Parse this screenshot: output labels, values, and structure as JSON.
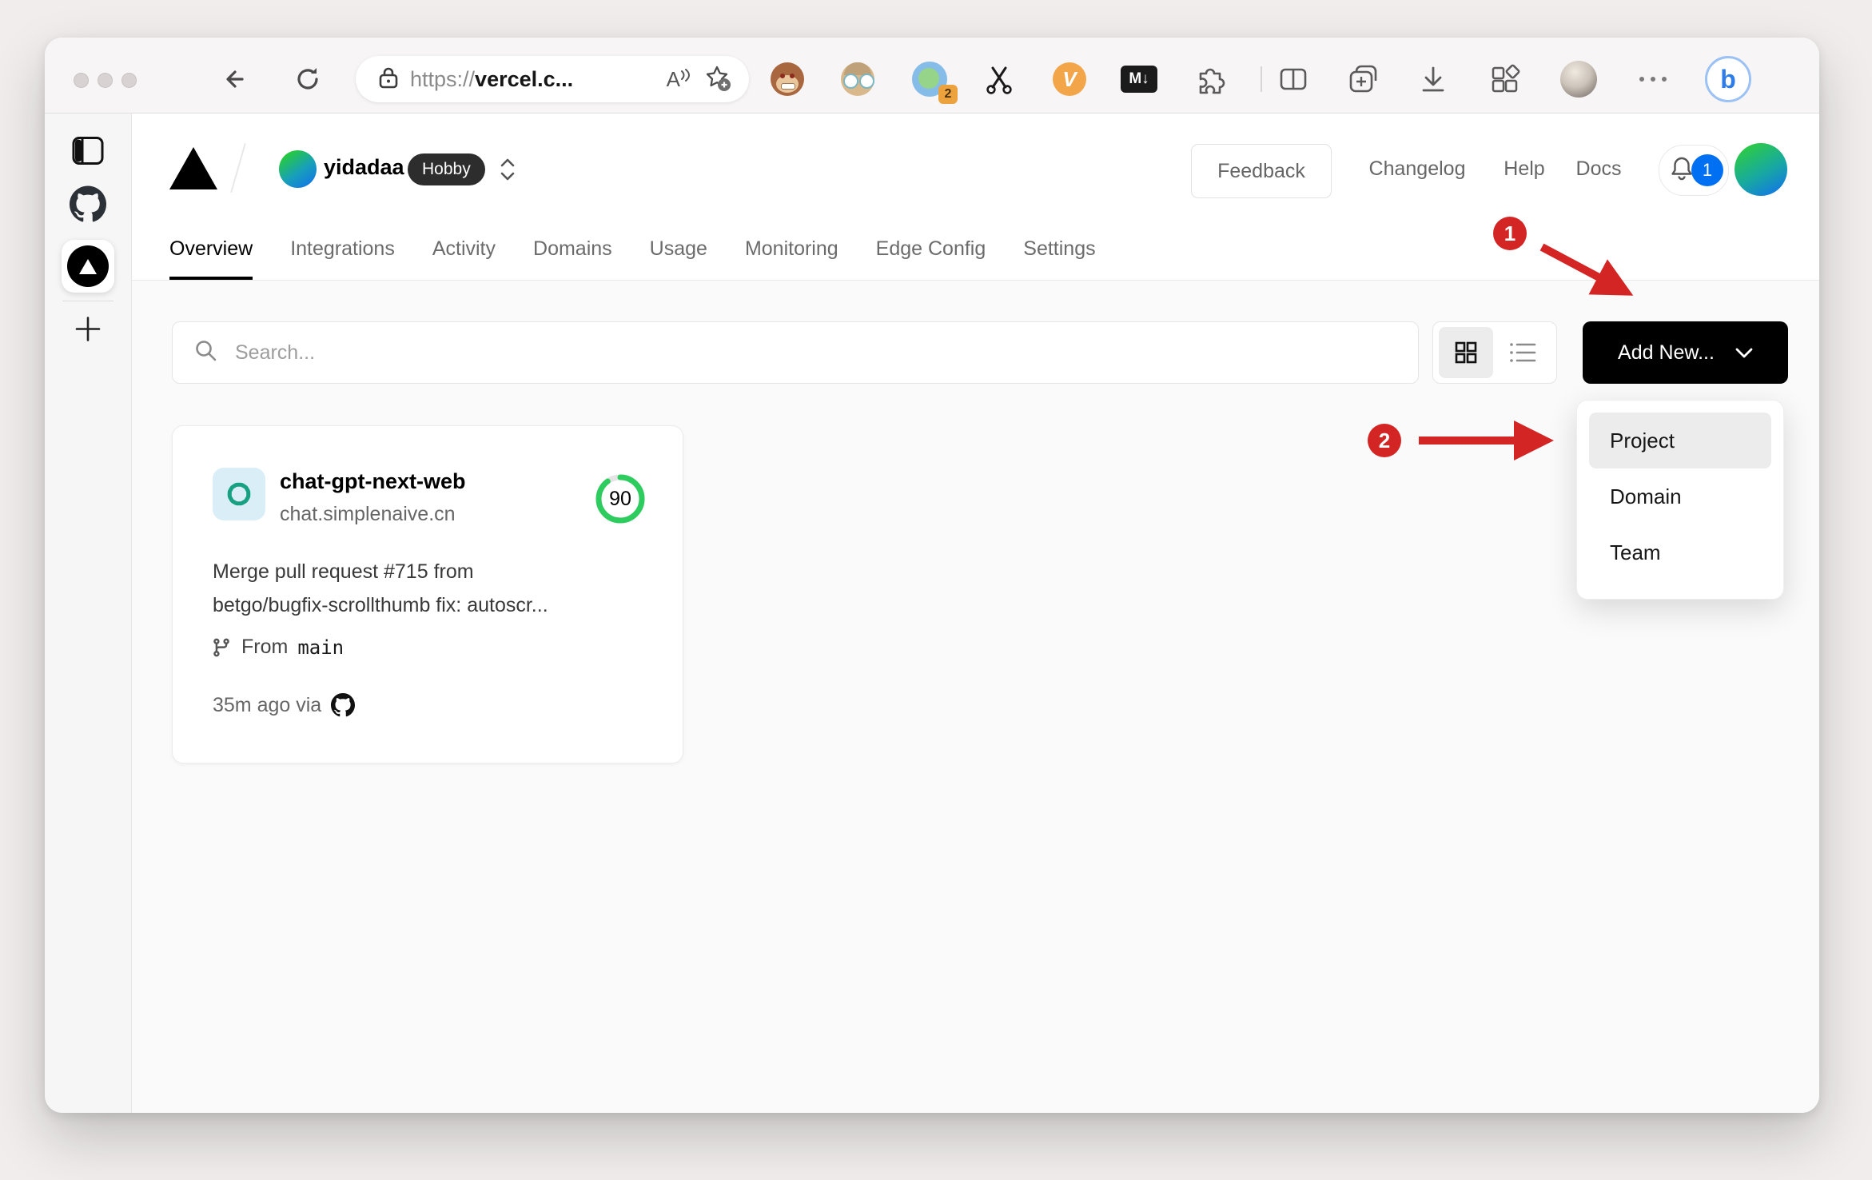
{
  "browser": {
    "url_scheme": "https://",
    "url_host": "vercel.c...",
    "read_aloud_label": "A",
    "ext_badge_count": "2",
    "v_ext_label": "V",
    "markdown_ext_label": "M↓",
    "bing_label": "b"
  },
  "vercel_header": {
    "team_name": "yidadaa",
    "plan": "Hobby",
    "feedback": "Feedback",
    "links": [
      "Changelog",
      "Help",
      "Docs"
    ],
    "notification_count": "1"
  },
  "tabs": [
    {
      "label": "Overview",
      "active": true
    },
    {
      "label": "Integrations"
    },
    {
      "label": "Activity"
    },
    {
      "label": "Domains"
    },
    {
      "label": "Usage"
    },
    {
      "label": "Monitoring"
    },
    {
      "label": "Edge Config"
    },
    {
      "label": "Settings"
    }
  ],
  "controls": {
    "search_placeholder": "Search...",
    "add_new": "Add New..."
  },
  "project": {
    "name": "chat-gpt-next-web",
    "domain": "chat.simplenaive.cn",
    "score": "90",
    "commit_line1": "Merge pull request #715 from",
    "commit_line2": "betgo/bugfix-scrollthumb fix: autoscr...",
    "from_label": "From",
    "branch": "main",
    "deployed": "35m ago via"
  },
  "dropdown": {
    "items": [
      "Project",
      "Domain",
      "Team"
    ]
  },
  "annotations": {
    "step1": "1",
    "step2": "2"
  },
  "colors": {
    "annotation_red": "#d42525",
    "score_green": "#2ecc5e",
    "badge_blue": "#0070f3"
  }
}
